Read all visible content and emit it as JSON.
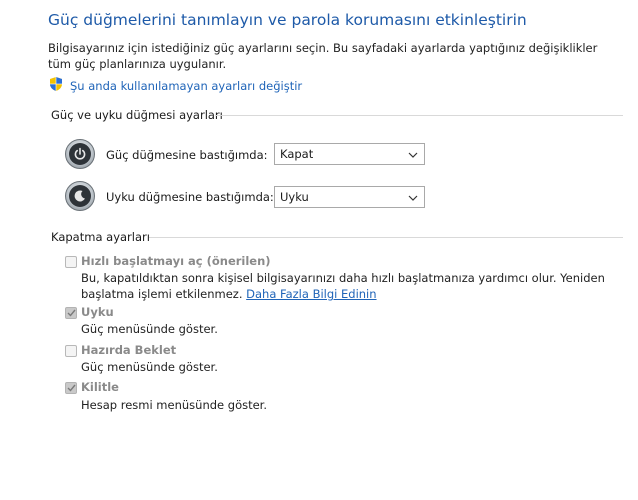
{
  "header": {
    "title": "Güç düğmelerini tanımlayın ve parola korumasını etkinleştirin",
    "description": "Bilgisayarınız için istediğiniz güç ayarlarını seçin. Bu sayfadaki ayarlarda yaptığınız değişiklikler tüm güç planlarınıza uygulanır.",
    "change_settings_link": "Şu anda kullanılamayan ayarları değiştir"
  },
  "power_buttons": {
    "section_title": "Güç ve uyku düğmesi ayarları",
    "power_button": {
      "label": "Güç düğmesine bastığımda:",
      "selected": "Kapat"
    },
    "sleep_button": {
      "label": "Uyku düğmesine bastığımda:",
      "selected": "Uyku"
    }
  },
  "shutdown": {
    "section_title": "Kapatma ayarları",
    "fast_startup": {
      "label": "Hızlı başlatmayı aç (önerilen)",
      "checked": false,
      "desc": "Bu, kapatıldıktan sonra kişisel bilgisayarınızı daha hızlı başlatmanıza yardımcı olur. Yeniden başlatma işlemi etkilenmez.",
      "link": "Daha Fazla Bilgi Edinin"
    },
    "sleep": {
      "label": "Uyku",
      "checked": true,
      "desc": "Güç menüsünde göster."
    },
    "hibernate": {
      "label": "Hazırda Beklet",
      "checked": false,
      "desc": "Güç menüsünde göster."
    },
    "lock": {
      "label": "Kilitle",
      "checked": true,
      "desc": "Hesap resmi menüsünde göster."
    }
  },
  "colors": {
    "title": "#1e5aa8",
    "link": "#1f64b8",
    "disabled_text": "#8a8a8a"
  },
  "icons": [
    "uac-shield-icon",
    "power-button-icon",
    "sleep-button-icon",
    "chevron-down-icon",
    "checkmark-icon"
  ]
}
